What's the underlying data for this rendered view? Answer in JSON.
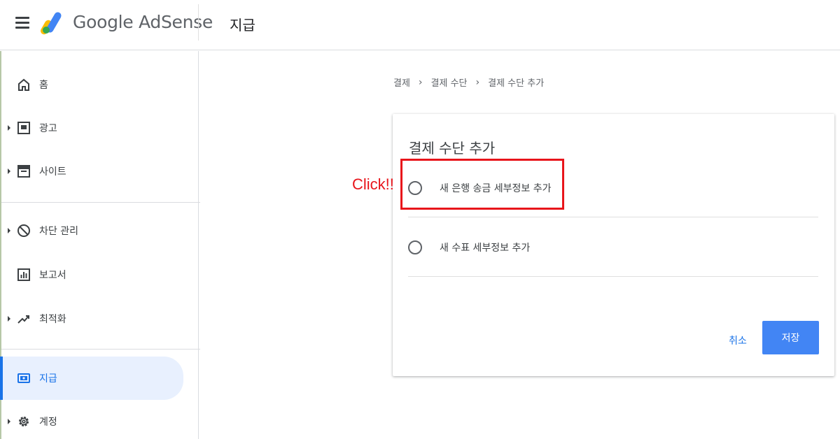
{
  "header": {
    "brand": "Google AdSense",
    "page_title": "지급"
  },
  "sidebar": {
    "items": [
      {
        "label": "홈",
        "icon": "home-icon"
      },
      {
        "label": "광고",
        "icon": "ad-unit-icon"
      },
      {
        "label": "사이트",
        "icon": "sites-icon"
      },
      {
        "label": "차단 관리",
        "icon": "block-icon"
      },
      {
        "label": "보고서",
        "icon": "reports-icon"
      },
      {
        "label": "최적화",
        "icon": "trending-up-icon"
      },
      {
        "label": "지급",
        "icon": "payments-icon",
        "active": true
      },
      {
        "label": "계정",
        "icon": "gear-icon"
      }
    ]
  },
  "breadcrumb": [
    "결제",
    "결제 수단",
    "결제 수단 추가"
  ],
  "card": {
    "title": "결제 수단 추가",
    "options": [
      {
        "label": "새 은행 송금 세부정보 추가",
        "selected": false
      },
      {
        "label": "새 수표 세부정보 추가",
        "selected": false
      }
    ],
    "cancel_label": "취소",
    "save_label": "저장"
  },
  "annotation": {
    "note": "Click!!",
    "color": "#e8151b"
  },
  "colors": {
    "accent": "#1a73e8",
    "save_button": "#4285f4",
    "active_bg": "#e8f0fe"
  }
}
